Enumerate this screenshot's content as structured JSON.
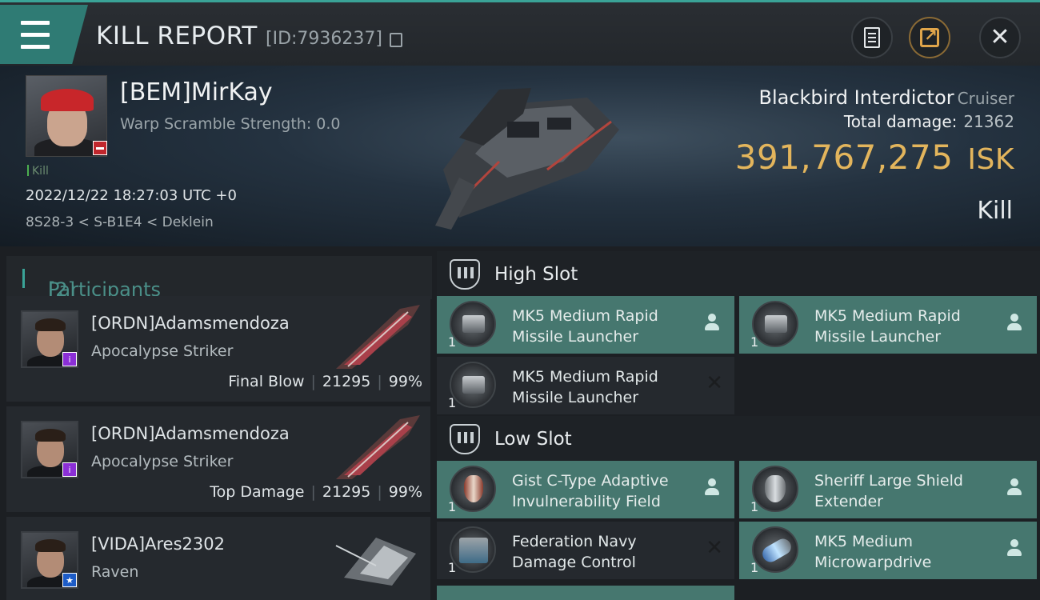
{
  "header": {
    "title": "KILL REPORT",
    "report_id": "[ID:7936237]"
  },
  "victim": {
    "name": "[BEM]MirKay",
    "warp_scramble": "Warp Scramble Strength: 0.0",
    "kill_tag": "Kill",
    "datetime": "2022/12/22 18:27:03 UTC +0",
    "location": "8S28-3 < S-B1E4 < Deklein",
    "ship_name": "Blackbird Interdictor",
    "ship_class": "Cruiser",
    "total_damage_label": "Total damage:",
    "total_damage_value": "21362",
    "isk_value": "391,767,275",
    "isk_unit": "ISK",
    "result": "Kill"
  },
  "participants": {
    "label": "Participants",
    "count": "[2]",
    "rows": [
      {
        "name": "[ORDN]Adamsmendoza",
        "ship": "Apocalypse Striker",
        "role": "Final Blow",
        "damage": "21295",
        "pct": "99%",
        "badge": "i"
      },
      {
        "name": "[ORDN]Adamsmendoza",
        "ship": "Apocalypse Striker",
        "role": "Top Damage",
        "damage": "21295",
        "pct": "99%",
        "badge": "i"
      },
      {
        "name": "[VIDA]Ares2302",
        "ship": "Raven",
        "role": "",
        "damage": "",
        "pct": "",
        "badge": "★"
      }
    ]
  },
  "high_slot": {
    "title": "High Slot",
    "modules": [
      {
        "line1": "MK5 Medium Rapid",
        "line2": "Missile Launcher",
        "qty": "1",
        "status": "dropped"
      },
      {
        "line1": "MK5 Medium Rapid",
        "line2": "Missile Launcher",
        "qty": "1",
        "status": "dropped"
      },
      {
        "line1": "MK5 Medium Rapid",
        "line2": "Missile Launcher",
        "qty": "1",
        "status": "destroyed"
      }
    ]
  },
  "low_slot": {
    "title": "Low Slot",
    "modules": [
      {
        "line1": "Gist C-Type Adaptive",
        "line2": "Invulnerability Field",
        "qty": "1",
        "status": "dropped"
      },
      {
        "line1": "Sheriff Large Shield",
        "line2": "Extender",
        "qty": "1",
        "status": "dropped"
      },
      {
        "line1": "Federation Navy",
        "line2": "Damage Control",
        "qty": "1",
        "status": "destroyed"
      },
      {
        "line1": "MK5 Medium",
        "line2": "Microwarpdrive",
        "qty": "1",
        "status": "dropped"
      }
    ]
  },
  "colors": {
    "accent": "#3aa397",
    "isk": "#e3b55c",
    "dropped_bg": "#46776f",
    "destroyed_bg": "#25292e"
  }
}
